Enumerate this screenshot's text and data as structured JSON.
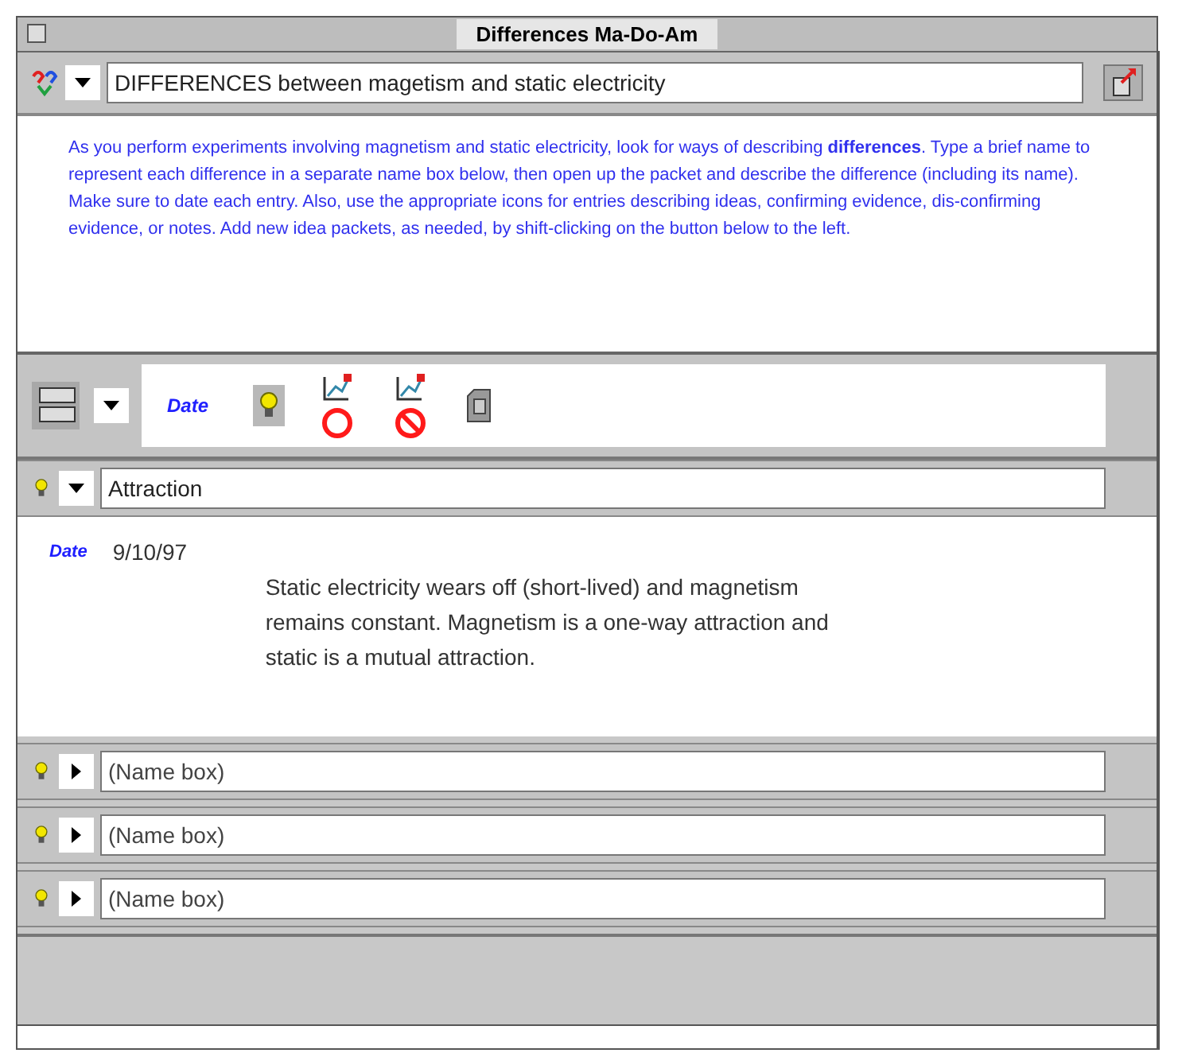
{
  "window": {
    "title": "Differences Ma-Do-Am"
  },
  "topic": {
    "value": "DIFFERENCES between magetism and static electricity"
  },
  "instructions": "As you perform experiments involving magnetism and static electricity, look for ways of describing **differences**.  Type a brief name to represent each difference in a separate name box below, then open up the packet and describe the difference (including its name).  Make sure to date each entry. Also, use the appropriate icons for entries describing ideas, confirming evidence, dis-confirming evidence, or notes.  Add new idea packets, as needed, by shift-clicking on the button below to the left.",
  "toolbar": [
    {
      "kind": "date",
      "label": "Date"
    },
    {
      "kind": "idea"
    },
    {
      "kind": "confirm"
    },
    {
      "kind": "disconfirm"
    },
    {
      "kind": "note"
    }
  ],
  "packets": [
    {
      "name": "Attraction",
      "expanded": true,
      "entry": {
        "date_label": "Date",
        "date": "9/10/97",
        "text": "Static electricity wears off (short-lived) and magnetism remains constant. Magnetism is a one-way attraction and static is a mutual attraction."
      }
    },
    {
      "placeholder": "(Name box)",
      "expanded": false
    },
    {
      "placeholder": "(Name box)",
      "expanded": false
    },
    {
      "placeholder": "(Name box)",
      "expanded": false
    }
  ]
}
